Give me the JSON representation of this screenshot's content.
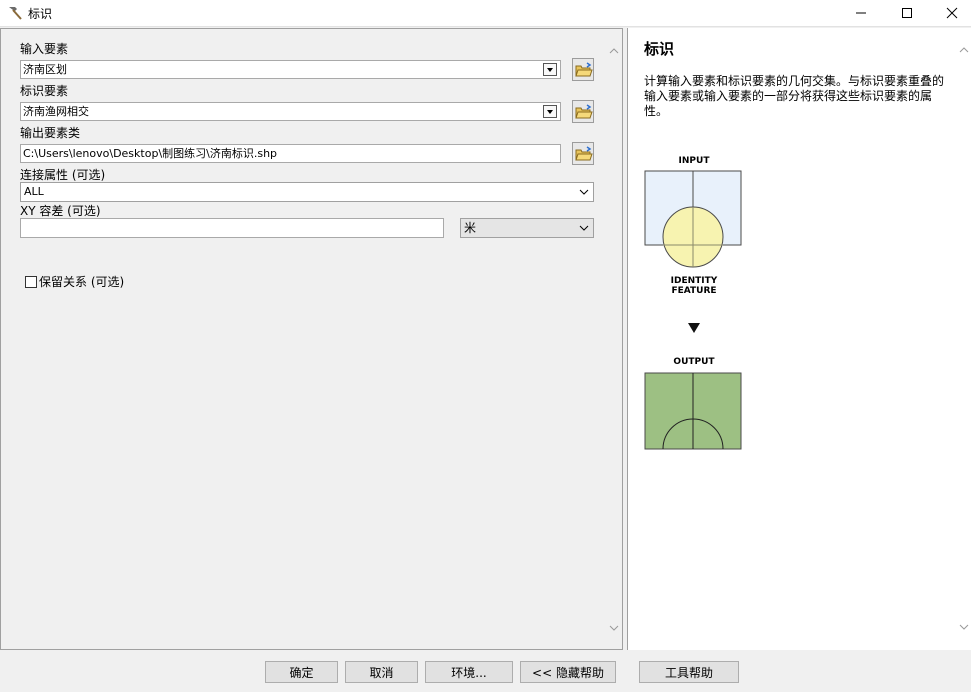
{
  "window": {
    "title": "标识",
    "icon": "hammer-icon"
  },
  "form": {
    "input_label": "输入要素",
    "input_value": "济南区划",
    "identity_label": "标识要素",
    "identity_value": "济南渔网相交",
    "output_label": "输出要素类",
    "output_value": "C:\\Users\\lenovo\\Desktop\\制图练习\\济南标识.shp",
    "join_label": "连接属性 (可选)",
    "join_value": "ALL",
    "xy_label": "XY 容差 (可选)",
    "xy_value": "",
    "unit_value": "米",
    "keep_label": "保留关系 (可选)",
    "keep_checked": false
  },
  "help": {
    "title": "标识",
    "body": "计算输入要素和标识要素的几何交集。与标识要素重叠的输入要素或输入要素的一部分将获得这些标识要素的属性。",
    "diagram": {
      "input_label": "INPUT",
      "identity_label_1": "IDENTITY",
      "identity_label_2": "FEATURE",
      "output_label": "OUTPUT"
    }
  },
  "buttons": {
    "ok": "确定",
    "cancel": "取消",
    "env": "环境...",
    "hide_help": "<< 隐藏帮助",
    "tool_help": "工具帮助"
  },
  "colors": {
    "input_fill": "#e8f1fb",
    "identity_fill": "#f7f3b0",
    "output_fill": "#9dc083"
  }
}
